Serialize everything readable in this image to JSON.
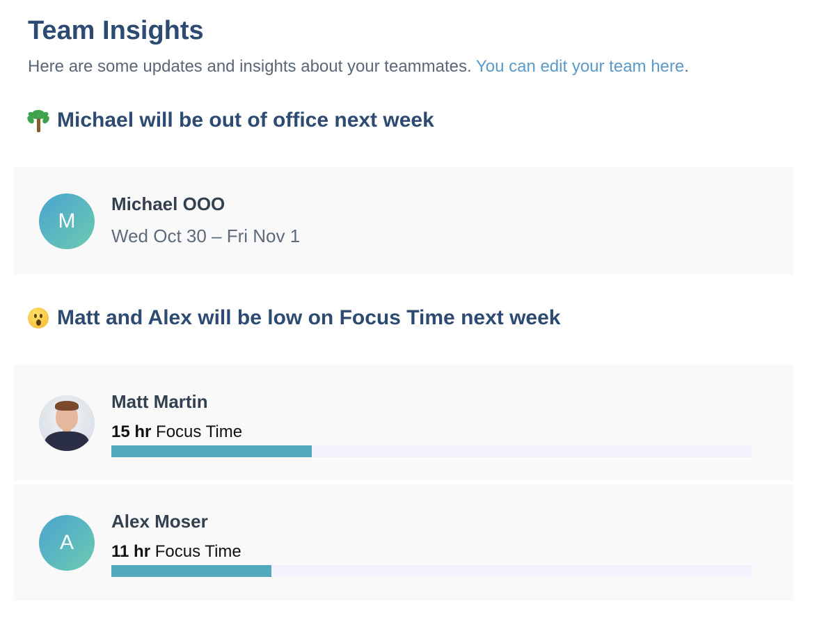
{
  "header": {
    "title": "Team Insights",
    "subtitle_text": "Here are some updates and insights about your teammates. ",
    "edit_link": "You can edit your team here",
    "subtitle_end": "."
  },
  "sections": [
    {
      "icon": "palm-tree-icon",
      "heading": "Michael will be out of office next week",
      "cards": [
        {
          "avatar_letter": "M",
          "name": "Michael OOO",
          "dates": "Wed Oct 30 – Fri Nov 1"
        }
      ]
    },
    {
      "icon": "surprised-face-icon",
      "heading": "Matt and Alex will be low on Focus Time next week",
      "cards": [
        {
          "avatar": "photo",
          "name": "Matt Martin",
          "hours": "15 hr",
          "label": " Focus Time",
          "progress": 0.313
        },
        {
          "avatar_letter": "A",
          "name": "Alex Moser",
          "hours": "11 hr",
          "label": " Focus Time",
          "progress": 0.25
        }
      ]
    }
  ],
  "colors": {
    "heading": "#2c4a72",
    "link": "#5b9ac8",
    "bar_fill": "#52a8bd",
    "bar_track": "#f1f2fb",
    "card_bg": "#f9f9f9"
  }
}
